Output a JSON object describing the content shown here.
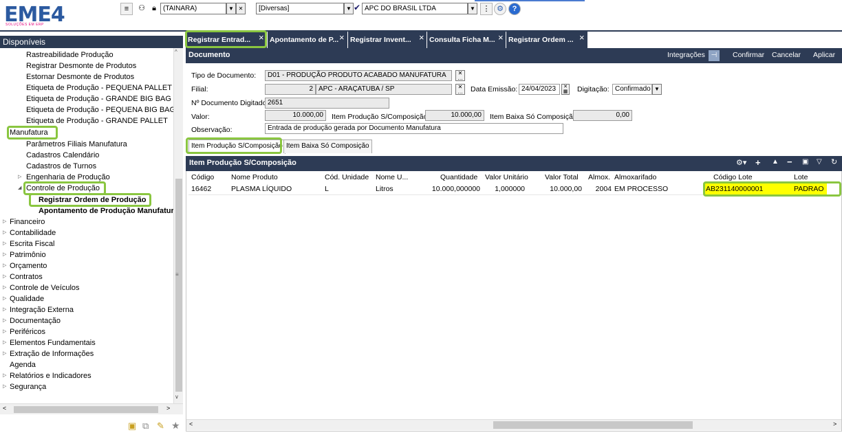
{
  "app": {
    "logo": "EME4",
    "logo_sub": "SOLUÇÕES EM ERP"
  },
  "toolbar": {
    "user_combo": "(TAINARA)",
    "category_combo": "[Diversas]",
    "company_combo": "APC DO BRASIL LTDA"
  },
  "sidebar": {
    "header": "Disponíveis",
    "items": [
      {
        "label": "Rastreabilidade Produção"
      },
      {
        "label": "Registrar Desmonte de Produtos"
      },
      {
        "label": "Estornar Desmonte de Produtos"
      },
      {
        "label": "Etiqueta de Produção - PEQUENA PALLET"
      },
      {
        "label": "Etiqueta de Produção - GRANDE BIG BAG"
      },
      {
        "label": "Etiqueta de Produção - PEQUENA BIG BAG"
      },
      {
        "label": "Etiqueta de Produção - GRANDE PALLET"
      },
      {
        "label": "Manufatura"
      },
      {
        "label": "Parâmetros Filiais Manufatura"
      },
      {
        "label": "Cadastros Calendário"
      },
      {
        "label": "Cadastros de Turnos"
      },
      {
        "label": "Engenharia de Produção"
      },
      {
        "label": "Controle de Produção"
      },
      {
        "label": "Registrar Ordem de Produção"
      },
      {
        "label": "Apontamento de Produção Manufatura"
      },
      {
        "label": "Financeiro"
      },
      {
        "label": "Contabilidade"
      },
      {
        "label": "Escrita Fiscal"
      },
      {
        "label": "Patrimônio"
      },
      {
        "label": "Orçamento"
      },
      {
        "label": "Contratos"
      },
      {
        "label": "Controle de Veículos"
      },
      {
        "label": "Qualidade"
      },
      {
        "label": "Integração Externa"
      },
      {
        "label": "Documentação"
      },
      {
        "label": "Periféricos"
      },
      {
        "label": "Elementos Fundamentais"
      },
      {
        "label": "Extração de Informações"
      },
      {
        "label": "Agenda"
      },
      {
        "label": "Relatórios e Indicadores"
      },
      {
        "label": "Segurança"
      }
    ]
  },
  "tabs": [
    {
      "label": "Registrar Entrad..."
    },
    {
      "label": "Apontamento de P..."
    },
    {
      "label": "Registrar Invent..."
    },
    {
      "label": "Consulta Ficha M..."
    },
    {
      "label": "Registrar Ordem ..."
    }
  ],
  "document": {
    "title": "Documento",
    "actions": {
      "integracoes": "Integrações",
      "confirmar": "Confirmar",
      "cancelar": "Cancelar",
      "aplicar": "Aplicar"
    },
    "fields": {
      "tipo_label": "Tipo de Documento:",
      "tipo_value": "D01 - PRODUÇÃO PRODUTO ACABADO MANUFATURA",
      "filial_label": "Filial:",
      "filial_code": "2",
      "filial_value": "APC - ARAÇATUBA / SP",
      "data_label": "Data Emissão:",
      "data_value": "24/04/2023",
      "digitacao_label": "Digitação:",
      "digitacao_value": "Confirmado",
      "ndoc_label": "Nº Documento Digitado:",
      "ndoc_value": "2651",
      "valor_label": "Valor:",
      "valor_value": "10.000,00",
      "item_prod_label": "Item Produção S/Composição",
      "item_prod_value": "10.000,00",
      "item_baixa_label": "Item Baixa Só Composição",
      "item_baixa_value": "0,00",
      "obs_label": "Observação:",
      "obs_value": "Entrada de produção gerada por Documento Manufatura"
    }
  },
  "subtabs": [
    {
      "label": "Item Produção S/Composição"
    },
    {
      "label": "Item Baixa Só Composição"
    }
  ],
  "grid": {
    "title": "Item Produção S/Composição",
    "columns": [
      "Código",
      "Nome Produto",
      "Cód. Unidade",
      "Nome U...",
      "Quantidade",
      "Valor Unitário",
      "Valor Total",
      "Almox.",
      "Almoxarifado",
      "Código Lote",
      "Lote"
    ],
    "rows": [
      {
        "codigo": "16462",
        "nome_produto": "PLASMA LÍQUIDO",
        "cod_unidade": "L",
        "nome_unidade": "Litros",
        "quantidade": "10.000,000000",
        "valor_unitario": "1,000000",
        "valor_total": "10.000,00",
        "almox": "2004",
        "almoxarifado": "EM PROCESSO",
        "codigo_lote": "AB231140000001",
        "lote": "PADRAO"
      }
    ]
  },
  "colors": {
    "header_bg": "#2d3b55",
    "highlight_green": "#8ac640",
    "highlight_yellow": "#ffff00"
  }
}
